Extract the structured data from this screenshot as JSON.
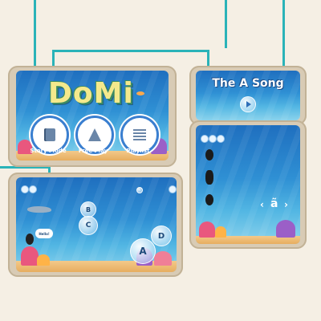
{
  "app": {
    "logo_text": "DoMi"
  },
  "home_menu": {
    "story_mode": "Story Mode",
    "free_play": "Free Play",
    "playlist": "Playlist"
  },
  "song_screen": {
    "title": "The A Song"
  },
  "free_play_screen": {
    "bubble_letters": [
      "B",
      "C",
      "D",
      "A"
    ],
    "speech_bubble": "Hello!"
  },
  "song_play_screen": {
    "letter": "ã",
    "nav_prev": "‹",
    "nav_next": "›"
  },
  "colors": {
    "wire": "#2ab3b8",
    "frame": "#d8cbb5",
    "background": "#f5efe4",
    "ocean_top": "#1f6fbf"
  }
}
